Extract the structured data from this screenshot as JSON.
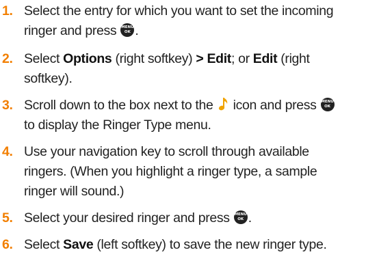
{
  "steps": [
    {
      "num": "1.",
      "parts": {
        "a": "Select the entry for which you want to set the incoming",
        "b": "ringer and press ",
        "c": "."
      }
    },
    {
      "num": "2.",
      "parts": {
        "a": "Select ",
        "b": "Options",
        "c": " (right softkey) ",
        "d": "> Edit",
        "e": "; or ",
        "f": "Edit",
        "g": " (right",
        "h": "softkey)."
      }
    },
    {
      "num": "3.",
      "parts": {
        "a": "Scroll down to the box next to the ",
        "b": " icon and press ",
        "c": "to display the Ringer Type menu."
      }
    },
    {
      "num": "4.",
      "parts": {
        "a": "Use your navigation key to scroll through available",
        "b": "ringers. (When you highlight a ringer type, a sample",
        "c": "ringer will sound.)"
      }
    },
    {
      "num": "5.",
      "parts": {
        "a": "Select your desired ringer and press ",
        "b": "."
      }
    },
    {
      "num": "6.",
      "parts": {
        "a": "Select ",
        "b": "Save",
        "c": " (left softkey) to save the new ringer type."
      }
    }
  ],
  "menu_key": {
    "line1": "MENU",
    "line2": "OK"
  },
  "icons": {
    "menu_key": "menu-ok-key-icon",
    "ringer": "musical-note-icon"
  },
  "colors": {
    "step_number": "#f27f00",
    "body_text": "#222222",
    "key_background": "#222222"
  }
}
